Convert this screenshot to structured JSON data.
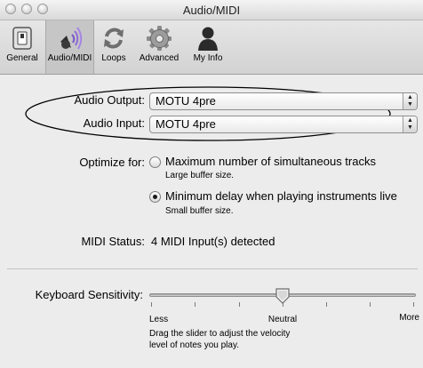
{
  "window": {
    "title": "Audio/MIDI"
  },
  "toolbar": {
    "items": [
      {
        "label": "General",
        "icon": "switch-icon"
      },
      {
        "label": "Audio/MIDI",
        "icon": "speaker-icon"
      },
      {
        "label": "Loops",
        "icon": "loop-arrows-icon"
      },
      {
        "label": "Advanced",
        "icon": "gear-icon"
      },
      {
        "label": "My Info",
        "icon": "person-icon"
      }
    ],
    "selected": "Audio/MIDI"
  },
  "audio": {
    "output_label": "Audio Output:",
    "output_value": "MOTU 4pre",
    "input_label": "Audio Input:",
    "input_value": "MOTU 4pre"
  },
  "optimize": {
    "label": "Optimize for:",
    "options": [
      {
        "title": "Maximum number of simultaneous tracks",
        "note": "Large buffer size.",
        "selected": false
      },
      {
        "title": "Minimum delay when playing instruments live",
        "note": "Small buffer size.",
        "selected": true
      }
    ]
  },
  "midi": {
    "label": "MIDI Status:",
    "value": "4 MIDI Input(s) detected"
  },
  "keyboard": {
    "label": "Keyboard Sensitivity:",
    "min_label": "Less",
    "mid_label": "Neutral",
    "max_label": "More",
    "value_fraction": 0.5,
    "help": "Drag the slider to adjust the velocity",
    "help2": "level of notes you play."
  }
}
